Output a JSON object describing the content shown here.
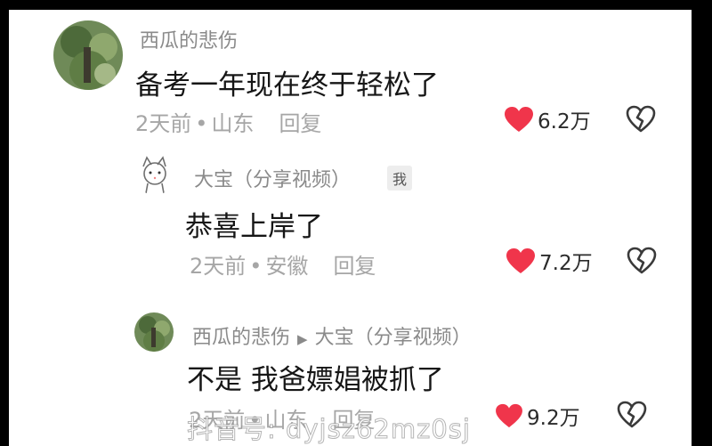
{
  "comments": [
    {
      "username": "西瓜的悲伤",
      "text": "备考一年现在终于轻松了",
      "time": "2天前",
      "location": "山东",
      "reply_label": "回复",
      "likes": "6.2万"
    },
    {
      "username": "大宝（分享视频）",
      "badge": "我",
      "text": "恭喜上岸了",
      "time": "2天前",
      "location": "安徽",
      "reply_label": "回复",
      "likes": "7.2万"
    },
    {
      "username": "西瓜的悲伤",
      "reply_to": "大宝（分享视频）",
      "text": "不是 我爸嫖娼被抓了",
      "time": "2天前",
      "location": "山东",
      "reply_label": "回复",
      "likes": "9.2万"
    }
  ],
  "watermark": "抖音号: dyjsz62mz0sj",
  "colors": {
    "heart": "#f0354b",
    "muted": "#a6a6a6",
    "username": "#8a8a8a"
  },
  "icons": [
    "heart-icon",
    "broken-heart-icon",
    "reply-arrow-icon"
  ]
}
